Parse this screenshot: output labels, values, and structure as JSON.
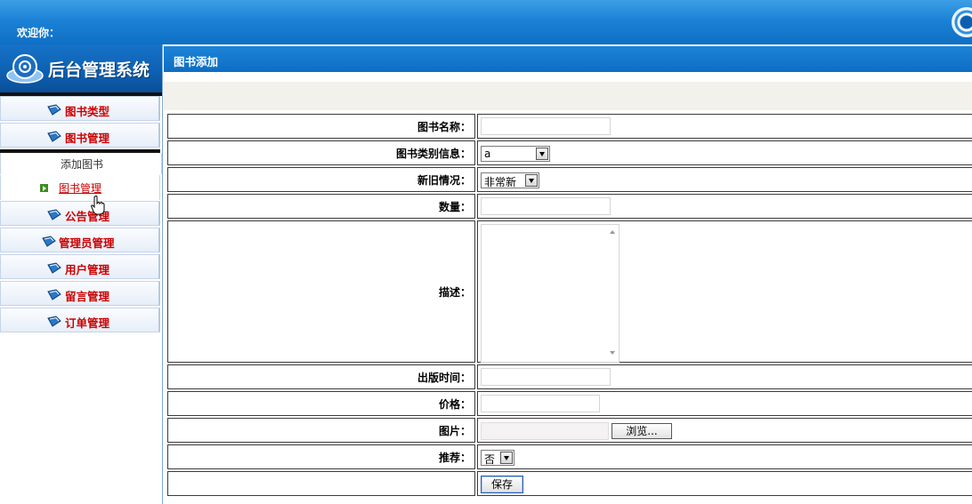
{
  "header": {
    "welcome": "欢迎你："
  },
  "sidebar": {
    "title": "后台管理系统",
    "menu": [
      {
        "label": "图书类型"
      },
      {
        "label": "图书管理"
      },
      {
        "label": "公告管理"
      },
      {
        "label": "管理员管理"
      },
      {
        "label": "用户管理"
      },
      {
        "label": "留言管理"
      },
      {
        "label": "订单管理"
      }
    ],
    "submenu": {
      "header": "添加图书",
      "link": "图书管理"
    }
  },
  "main": {
    "title": "图书添加",
    "form": {
      "name_label": "图书名称：",
      "category_label": "图书类别信息：",
      "category_value": "a",
      "condition_label": "新旧情况：",
      "condition_value": "非常新",
      "quantity_label": "数量：",
      "description_label": "描述：",
      "pubdate_label": "出版时间：",
      "price_label": "价格：",
      "image_label": "图片：",
      "browse_button": "浏览...",
      "recommend_label": "推荐：",
      "recommend_value": "否",
      "save_button": "保存"
    }
  },
  "colors": {
    "header_blue": "#1c84d8",
    "menu_red": "#cc0000"
  }
}
